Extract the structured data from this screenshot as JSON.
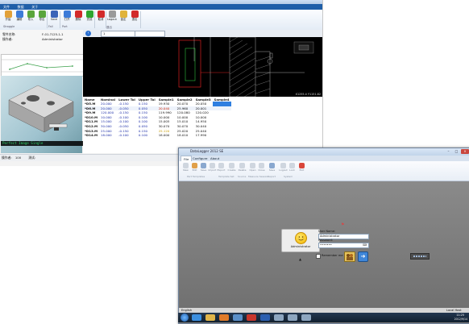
{
  "back_window": {
    "menu": [
      "文件",
      "数据",
      "关于"
    ],
    "ribbon_buttons": [
      {
        "label": "开始",
        "icon": "gear-icon",
        "color": "#e2a13a"
      },
      {
        "label": "编辑",
        "icon": "pencil-icon",
        "color": "#3d7bd8"
      },
      {
        "label": "导入",
        "icon": "import-icon",
        "color": "#5aa53c"
      },
      {
        "label": "导出",
        "icon": "export-icon",
        "color": "#5aa53c"
      },
      {
        "label": "Save",
        "icon": "save-icon",
        "color": "#3a63b8"
      },
      {
        "label": "打开",
        "icon": "open-icon",
        "color": "#3d7bd8"
      },
      {
        "label": "删除",
        "icon": "stop-icon",
        "color": "#d22a2a"
      },
      {
        "label": "完成",
        "icon": "check-icon",
        "color": "#2fa52f"
      },
      {
        "label": "取消",
        "icon": "close-icon",
        "color": "#d22a2a"
      },
      {
        "label": "Logout",
        "icon": "logout-icon",
        "color": "#9a9a9a"
      },
      {
        "label": "锁定",
        "icon": "lock-icon",
        "color": "#e0b33a"
      },
      {
        "label": "退出",
        "icon": "exit-icon",
        "color": "#d22a2a"
      }
    ],
    "ribbon_groups": [
      "Stroggle",
      "Fail",
      "Port",
      "退出"
    ],
    "info": {
      "part_label": "零件名称:",
      "part_value": "F-01-?125-1-1",
      "operator_label": "操作者:",
      "operator_value": "Administrator"
    },
    "cad_header": {
      "field_value": "1"
    },
    "cad_readout": "X1255.4 Y1151.82",
    "table": {
      "headers": [
        "Name",
        "Nominal",
        "Lower Tol",
        "Upper Tol",
        "Sample1",
        "Sample2",
        "Sample3",
        "Sample4"
      ],
      "rows": [
        {
          "name": "*D5.M",
          "nominal": "20.000",
          "lower": "-0.150",
          "upper": "0.150",
          "s1": "19.930",
          "s2": "20.070",
          "s3": "20.050",
          "s4": ""
        },
        {
          "name": "*D6.M",
          "nominal": "20.000",
          "lower": "-0.050",
          "upper": "0.050",
          "s1": "20.040",
          "s2": "25.960",
          "s3": "20.001",
          "s4": ""
        },
        {
          "name": "*D9.M",
          "nominal": "120.000",
          "lower": "-0.150",
          "upper": "0.150",
          "s1": "119.990",
          "s2": "120.080",
          "s3": "120.020",
          "s4": ""
        },
        {
          "name": "*D10.M",
          "nominal": "10.000",
          "lower": "-0.100",
          "upper": "0.100",
          "s1": "10.000",
          "s2": "10.000",
          "s3": "10.000",
          "s4": ""
        },
        {
          "name": "*D11.M",
          "nominal": "15.000",
          "lower": "-0.100",
          "upper": "0.100",
          "s1": "15.005",
          "s2": "15.010",
          "s3": "14.950",
          "s4": ""
        },
        {
          "name": "*D12.M",
          "nominal": "30.000",
          "lower": "-0.050",
          "upper": "0.050",
          "s1": "30.070",
          "s2": "30.070",
          "s3": "30.040",
          "s4": ""
        },
        {
          "name": "*D13.M",
          "nominal": "25.000",
          "lower": "-0.150",
          "upper": "0.150",
          "s1": "25.120",
          "s2": "25.020",
          "s3": "25.040",
          "s4": ""
        },
        {
          "name": "*D14.M",
          "nominal": "18.000",
          "lower": "-0.100",
          "upper": "0.100",
          "s1": "18.000",
          "s2": "18.010",
          "s3": "17.990",
          "s4": ""
        }
      ]
    },
    "render_caption": "Perfect Image Single",
    "status": {
      "left_label": "操作者:",
      "left_value": "100",
      "right_label": "测试:"
    }
  },
  "front_window": {
    "title": "DataLogger 2012 SE",
    "tabs": [
      "File",
      "Configure",
      "About"
    ],
    "ribbon_buttons": [
      {
        "label": "New",
        "icon": "new-icon"
      },
      {
        "label": "Edit",
        "icon": "pencil-icon"
      },
      {
        "label": "Save",
        "icon": "save-icon"
      },
      {
        "label": "Import",
        "icon": "import-icon"
      },
      {
        "label": "Export",
        "icon": "export-icon"
      },
      {
        "label": "Create",
        "icon": "create-icon"
      },
      {
        "label": "Delete",
        "icon": "delete-icon"
      },
      {
        "label": "Open",
        "icon": "open-icon"
      },
      {
        "label": "Close",
        "icon": "close-icon"
      },
      {
        "label": "Save",
        "icon": "save-icon"
      },
      {
        "label": "Logout",
        "icon": "logout-icon"
      },
      {
        "label": "Lock",
        "icon": "lock-icon"
      },
      {
        "label": "Exit",
        "icon": "exit-icon"
      }
    ],
    "ribbon_groups": [
      "Part Templates",
      "Template Set",
      "Source",
      "Measure Session",
      "Report",
      "System"
    ],
    "login": {
      "user_card_name": "Administrator",
      "username_label": "User Name:",
      "username_value": "Administrator",
      "password_label": "Password:",
      "password_value": "•••••••",
      "remember_label": "Remember me"
    },
    "status": {
      "language": "English",
      "right": "Local Host"
    }
  },
  "taskbar": {
    "clock_time": "11:25",
    "clock_date": "2012/9/14",
    "icons": [
      {
        "name": "ie-icon",
        "color": "#3b8fe0"
      },
      {
        "name": "folder-icon",
        "color": "#e0b54a"
      },
      {
        "name": "media-icon",
        "color": "#e07b2a"
      },
      {
        "name": "app-icon",
        "color": "#5a8fc8"
      },
      {
        "name": "pdf-icon",
        "color": "#c8362c"
      },
      {
        "name": "word-icon",
        "color": "#2b5fb0"
      },
      {
        "name": "app2-icon",
        "color": "#8da6c0"
      },
      {
        "name": "app3-icon",
        "color": "#8da6c0"
      },
      {
        "name": "app4-icon",
        "color": "#8da6c0"
      }
    ]
  }
}
